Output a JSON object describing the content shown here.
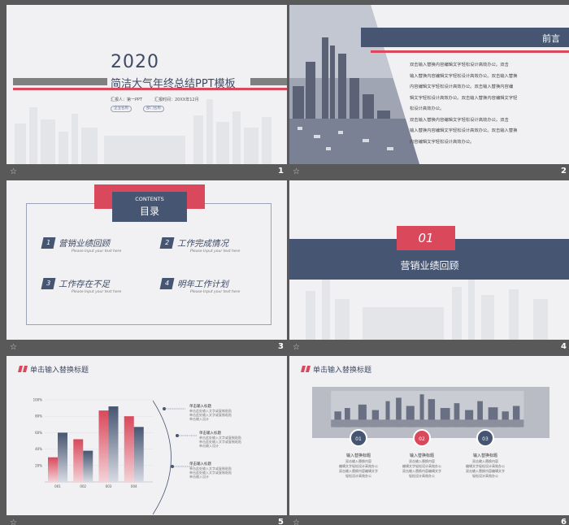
{
  "slides": [
    {
      "number": "1",
      "year": "2020",
      "title": "简洁大气年终总结PPT模板",
      "reporter": "汇报人：第一PPT",
      "report_time": "汇报时间：20XX年12月",
      "buttons": [
        "企业名称",
        "部门名称"
      ]
    },
    {
      "number": "2",
      "heading": "前言",
      "paragraphs": [
        "双击输入替换内容编辑文字轻松设计高效办公。双击",
        "输入替换内容编辑文字轻松设计高效办公。双击输入替换",
        "内容编辑文字轻松设计高效办公。双击输入替换内容编",
        "辑文字轻松设计高效办公。双击输入替换内容编辑文字轻",
        "松设计高效办公。",
        "双击输入替换内容编辑文字轻松设计高效办公。双击",
        "输入替换内容编辑文字轻松设计高效办公。双击输入替换",
        "内容编辑文字轻松设计高效办公。"
      ]
    },
    {
      "number": "3",
      "contents_en": "CONTENTS",
      "contents_cn": "目录",
      "items": [
        {
          "num": "1",
          "label": "营销业绩回顾",
          "sub": "Please Input your text here"
        },
        {
          "num": "2",
          "label": "工作完成情况",
          "sub": "Please Input your text here"
        },
        {
          "num": "3",
          "label": "工作存在不足",
          "sub": "Please Input your text here"
        },
        {
          "num": "4",
          "label": "明年工作计划",
          "sub": "Please Input your text here"
        }
      ]
    },
    {
      "number": "4",
      "section_num": "01",
      "section_title": "营销业绩回顾"
    },
    {
      "number": "5",
      "header": "单击输入替换标题",
      "labels": [
        {
          "title": "单击输入标题",
          "desc": [
            "单击此处输入文字或复制粘贴",
            "单击此处输入文字或复制粘贴",
            "单击输入设计"
          ]
        },
        {
          "title": "单击输入标题",
          "desc": [
            "单击此处输入文字或复制粘贴",
            "单击此处输入文字或复制粘贴",
            "单击输入设计"
          ]
        },
        {
          "title": "单击输入标题",
          "desc": [
            "单击此处输入文字或复制粘贴",
            "单击此处输入文字或复制粘贴",
            "单击输入设计"
          ]
        }
      ]
    },
    {
      "number": "6",
      "header": "单击输入替换标题",
      "steps": [
        {
          "num": "01",
          "title": "输入替换标题",
          "desc": [
            "双击输入替换内容",
            "编辑文字轻松设计高效办公",
            "双击输入替换内容编辑文字",
            "轻松设计高效办公"
          ]
        },
        {
          "num": "02",
          "title": "输入替换标题",
          "desc": [
            "双击输入替换内容",
            "编辑文字轻松设计高效办公",
            "双击输入替换内容编辑文字",
            "轻松设计高效办公"
          ]
        },
        {
          "num": "03",
          "title": "输入替换标题",
          "desc": [
            "双击输入替换内容",
            "编辑文字轻松设计高效办公",
            "双击输入替换内容编辑文字",
            "轻松设计高效办公"
          ]
        }
      ]
    }
  ],
  "colors": {
    "accent_red": "#d9485b",
    "accent_blue": "#465571",
    "slide_bg": "#f1f1f3",
    "grid_bg": "#595959"
  },
  "icons": {
    "footer": "star-icon"
  },
  "chart_data": {
    "type": "bar",
    "categories": [
      "001",
      "002",
      "003",
      "004"
    ],
    "series": [
      {
        "values": [
          30,
          52,
          87,
          80
        ]
      },
      {
        "values": [
          60,
          38,
          92,
          67
        ]
      }
    ],
    "yticks": [
      "20%",
      "40%",
      "60%",
      "80%",
      "100%"
    ],
    "ylim": [
      0,
      100
    ]
  }
}
